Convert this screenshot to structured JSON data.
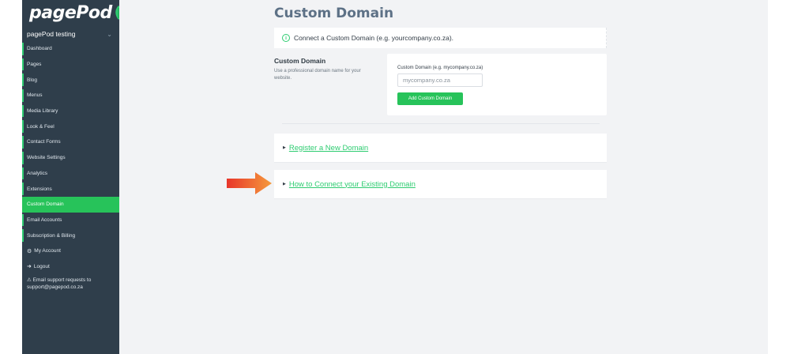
{
  "brand": {
    "logo_text": "pagePod",
    "accent": "#27c35a"
  },
  "site_selector": {
    "value": "pagePod testing"
  },
  "sidebar": {
    "items": [
      {
        "label": "Dashboard"
      },
      {
        "label": "Pages"
      },
      {
        "label": "Blog"
      },
      {
        "label": "Menus"
      },
      {
        "label": "Media Library"
      },
      {
        "label": "Look & Feel"
      },
      {
        "label": "Contact Forms"
      },
      {
        "label": "Website Settings"
      },
      {
        "label": "Analytics"
      },
      {
        "label": "Extensions"
      },
      {
        "label": "Custom Domain",
        "active": true
      },
      {
        "label": "Email Accounts"
      },
      {
        "label": "Subscription & Billing"
      },
      {
        "label": "My Account",
        "icon": "gear-icon"
      },
      {
        "label": "Logout",
        "icon": "logout-icon"
      }
    ],
    "support": {
      "line1": "Email support requests to",
      "line2": "support@pagepod.co.za",
      "icon": "warning-icon"
    }
  },
  "main": {
    "title": "Custom Domain",
    "notice": "Connect a Custom Domain (e.g. yourcompany.co.za).",
    "section_title": "Custom Domain",
    "section_desc": "Use a professional domain name for your website.",
    "form": {
      "label": "Custom Domain (e.g. mycompany.co.za)",
      "placeholder": "mycompany.co.za",
      "button": "Add Custom Domain"
    },
    "accordions": [
      {
        "label": "Register a New Domain"
      },
      {
        "label": "How to Connect your Existing Domain"
      }
    ]
  }
}
